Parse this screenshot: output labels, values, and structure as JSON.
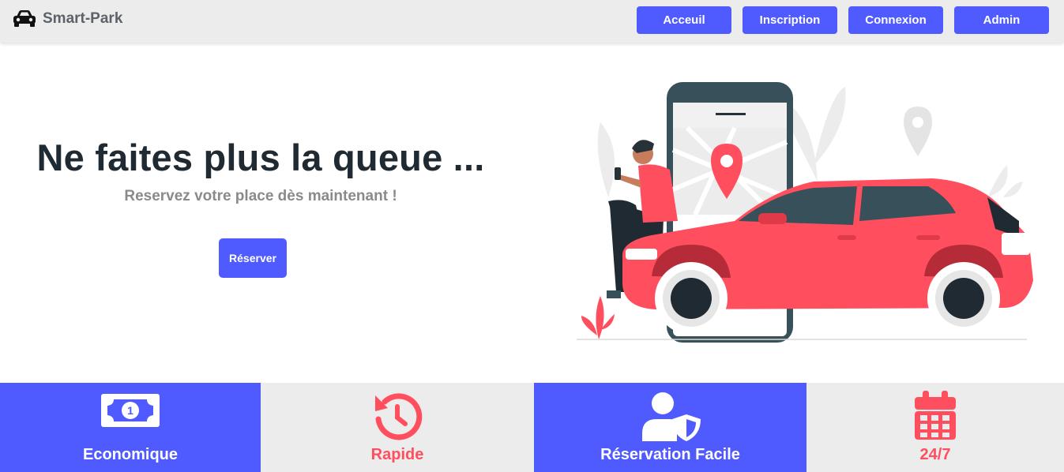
{
  "navbar": {
    "brand_name": "Smart-Park",
    "brand_icon": "car-icon",
    "links": [
      {
        "label": "Acceuil"
      },
      {
        "label": "Inscription"
      },
      {
        "label": "Connexion"
      },
      {
        "label": "Admin"
      }
    ],
    "button_color": "#4f5bff"
  },
  "hero": {
    "title": "Ne faites plus la queue ...",
    "subtitle": "Reservez votre place dès maintenant !",
    "cta_label": "Réserver",
    "illustration": "person-with-phone-and-red-car-illustration"
  },
  "features": [
    {
      "label": "Economique",
      "icon": "money-bill-icon",
      "theme": "blue"
    },
    {
      "label": "Rapide",
      "icon": "history-clock-icon",
      "theme": "grey"
    },
    {
      "label": "Réservation Facile",
      "icon": "user-shield-icon",
      "theme": "blue"
    },
    {
      "label": "24/7",
      "icon": "calendar-icon",
      "theme": "grey"
    }
  ],
  "colors": {
    "primary": "#4f5bff",
    "accent": "#ff4f5e",
    "light": "#ececec",
    "dark_text": "#1f2a33"
  }
}
